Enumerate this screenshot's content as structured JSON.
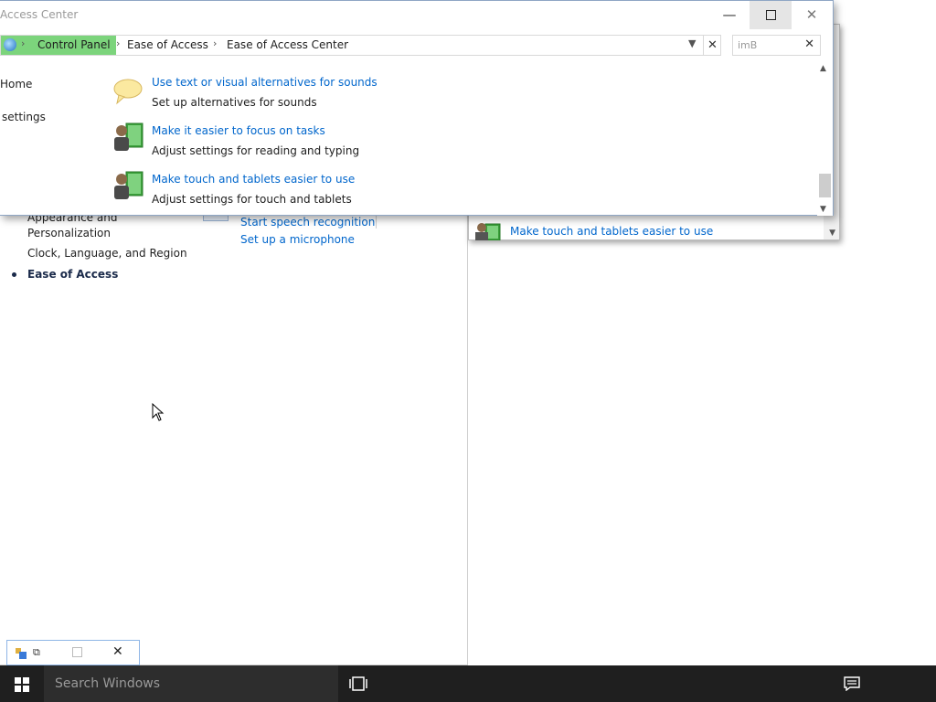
{
  "front_window": {
    "title": "Access Center",
    "address": {
      "crumbs": [
        "Control Panel",
        "Ease of Access",
        "Ease of Access Center"
      ],
      "separator": "›"
    },
    "search": {
      "value": "imB"
    },
    "left_nav": {
      "home": "Home",
      "settings": "settings"
    },
    "tasks": [
      {
        "link": "Use text or visual alternatives for sounds",
        "desc": "Set up alternatives for sounds",
        "icon": "speech-bubble-icon"
      },
      {
        "link": "Make it easier to focus on tasks",
        "desc": "Adjust settings for reading and typing",
        "icon": "user-book-icon"
      },
      {
        "link": "Make touch and tablets easier to use",
        "desc": "Adjust settings for touch and tablets",
        "icon": "user-book-icon"
      }
    ]
  },
  "background_window": {
    "nav": {
      "appearance": "Appearance and Personalization",
      "clock": "Clock, Language, and Region",
      "ease": "Ease of Access"
    },
    "speech_links": {
      "speech": "Start speech recognition",
      "mic": "Set up a microphone"
    }
  },
  "middle_window": {
    "link": "Make touch and tablets easier to use"
  },
  "taskbar": {
    "search_placeholder": "Search Windows"
  },
  "colors": {
    "link": "#0066cc",
    "breadcrumb_highlight": "#7cd47c",
    "taskbar": "#1f1f1f"
  }
}
